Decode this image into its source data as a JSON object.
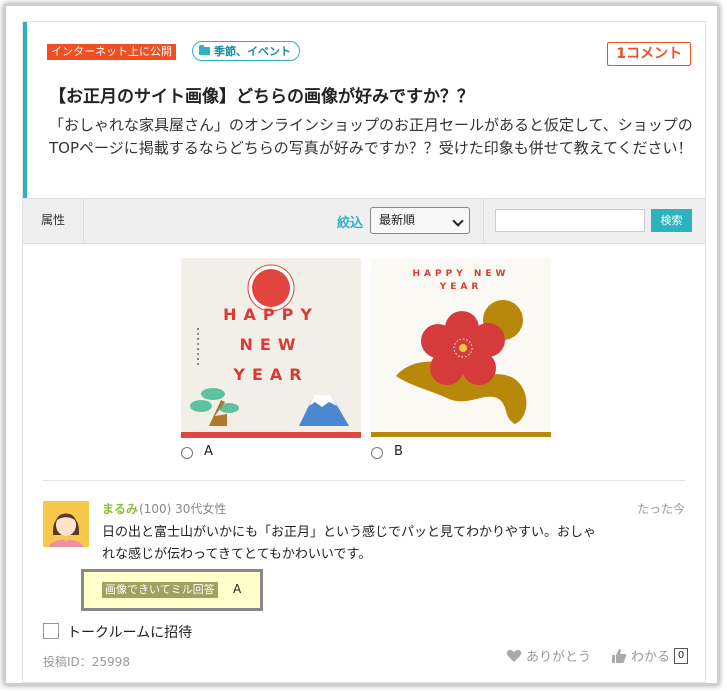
{
  "post": {
    "public_badge": "インターネット上に公開",
    "category": "季節、イベント",
    "comments_count": "1コメント",
    "title": "【お正月のサイト画像】どちらの画像が好みですか？？",
    "description": "「おしゃれな家具屋さん」のオンラインショップのお正月セールがあると仮定して、ショップのTOPページに掲載するならどちらの写真が好みですか？？受けた印象も併せて教えてください！"
  },
  "filter_bar": {
    "attribute_label": "属性",
    "narrow_label": "絞込",
    "sort_selected": "最新順",
    "search_placeholder": "",
    "search_button": "検索"
  },
  "choices": [
    {
      "label": "A",
      "image_text": [
        "HAPPY",
        "NEW",
        "YEAR"
      ]
    },
    {
      "label": "B",
      "image_text": [
        "HAPPY NEW",
        "YEAR"
      ]
    }
  ],
  "comment": {
    "user_name": "まるみ",
    "user_meta": "(100) 30代女性",
    "time": "たった今",
    "text": "日の出と富士山がいかにも「お正月」という感じでパッと見てわかりやすい。おしゃれな感じが伝わってきてとてもかわいいです。",
    "answer_tag": "画像できいてミル回答",
    "answer_value": "A",
    "invite_label": "トークルームに招待",
    "post_id": "投稿ID：25998",
    "thanks_label": "ありがとう",
    "agree_label": "わかる",
    "agree_count": "0"
  },
  "icons": [
    "folder-icon",
    "chevron-down-icon",
    "heart-icon",
    "thumbs-up-icon"
  ],
  "colors": {
    "accent": "#2db3bd",
    "badge": "#f04e23",
    "username": "#8fbf3a"
  }
}
